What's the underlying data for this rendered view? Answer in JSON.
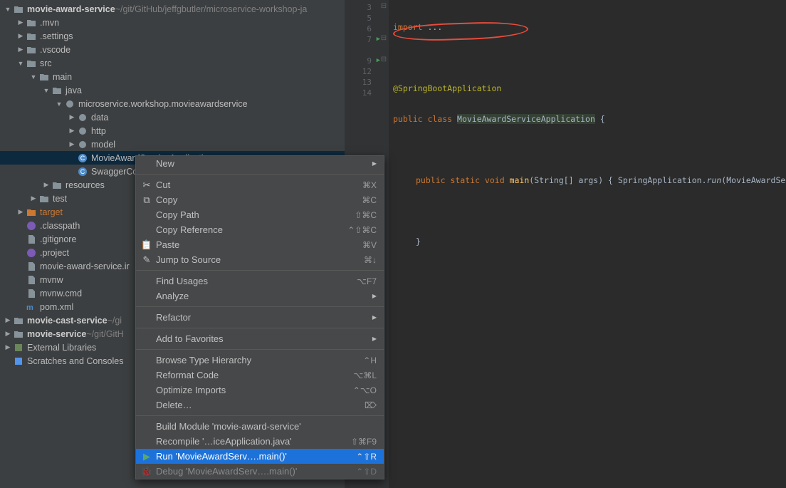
{
  "tree": [
    {
      "indent": 0,
      "chev": "▼",
      "icon": "folder",
      "label": "movie-award-service",
      "bold": true,
      "extra": "~/git/GitHub/jeffgbutler/microservice-workshop-ja"
    },
    {
      "indent": 1,
      "chev": "▶",
      "icon": "folder-dot",
      "label": ".mvn"
    },
    {
      "indent": 1,
      "chev": "▶",
      "icon": "folder",
      "label": ".settings"
    },
    {
      "indent": 1,
      "chev": "▶",
      "icon": "folder-dot",
      "label": ".vscode"
    },
    {
      "indent": 1,
      "chev": "▼",
      "icon": "folder-src",
      "label": "src"
    },
    {
      "indent": 2,
      "chev": "▼",
      "icon": "folder-src",
      "label": "main"
    },
    {
      "indent": 3,
      "chev": "▼",
      "icon": "folder-src",
      "label": "java"
    },
    {
      "indent": 4,
      "chev": "▼",
      "icon": "package",
      "label": "microservice.workshop.movieawardservice"
    },
    {
      "indent": 5,
      "chev": "▶",
      "icon": "package",
      "label": "data"
    },
    {
      "indent": 5,
      "chev": "▶",
      "icon": "package",
      "label": "http"
    },
    {
      "indent": 5,
      "chev": "▶",
      "icon": "package",
      "label": "model"
    },
    {
      "indent": 5,
      "chev": "",
      "icon": "class",
      "label": "MovieAwardServiceApplication",
      "selected": true
    },
    {
      "indent": 5,
      "chev": "",
      "icon": "class",
      "label": "SwaggerCo"
    },
    {
      "indent": 3,
      "chev": "▶",
      "icon": "folder-res",
      "label": "resources"
    },
    {
      "indent": 2,
      "chev": "▶",
      "icon": "folder-src",
      "label": "test"
    },
    {
      "indent": 1,
      "chev": "▶",
      "icon": "folder-orange",
      "label": "target",
      "orange": true
    },
    {
      "indent": 1,
      "chev": "",
      "icon": "eclipse",
      "label": ".classpath"
    },
    {
      "indent": 1,
      "chev": "",
      "icon": "file",
      "label": ".gitignore"
    },
    {
      "indent": 1,
      "chev": "",
      "icon": "eclipse",
      "label": ".project"
    },
    {
      "indent": 1,
      "chev": "",
      "icon": "file",
      "label": "movie-award-service.ir"
    },
    {
      "indent": 1,
      "chev": "",
      "icon": "file",
      "label": "mvnw"
    },
    {
      "indent": 1,
      "chev": "",
      "icon": "file",
      "label": "mvnw.cmd"
    },
    {
      "indent": 1,
      "chev": "",
      "icon": "maven",
      "label": "pom.xml"
    },
    {
      "indent": 0,
      "chev": "▶",
      "icon": "folder",
      "label": "movie-cast-service",
      "bold": true,
      "extra": "~/gi"
    },
    {
      "indent": 0,
      "chev": "▶",
      "icon": "folder",
      "label": "movie-service",
      "bold": true,
      "extra": "~/git/GitH"
    },
    {
      "indent": 0,
      "chev": "▶",
      "icon": "lib",
      "label": "External Libraries"
    },
    {
      "indent": 0,
      "chev": "",
      "icon": "scratch",
      "label": "Scratches and Consoles"
    }
  ],
  "gutter": [
    "3",
    "5",
    "6",
    "7",
    "",
    "9",
    "12",
    "13",
    "14"
  ],
  "runlines": [
    3,
    5
  ],
  "foldmarks": [
    0,
    3,
    5
  ],
  "code": {
    "l0": {
      "pre": "import ",
      "txt": "..."
    },
    "l2": "@SpringBootApplication",
    "l3": {
      "a": "public class ",
      "b": "MovieAwardServiceApplication",
      " c": " {"
    },
    "l5": {
      "a": "public static void ",
      "b": "main",
      "c": "(String[] args) { SpringApplication.",
      "d": "run",
      "e": "(MovieAwardSe"
    },
    "l6": "}",
    "rbrace": "}"
  },
  "menu": [
    {
      "label": "New",
      "sub": true
    },
    {
      "sep": true
    },
    {
      "icon": "cut",
      "label": "Cut",
      "sc": "⌘X"
    },
    {
      "icon": "copy",
      "label": "Copy",
      "sc": "⌘C"
    },
    {
      "label": "Copy Path",
      "sc": "⇧⌘C"
    },
    {
      "label": "Copy Reference",
      "sc": "⌃⇧⌘C"
    },
    {
      "icon": "paste",
      "label": "Paste",
      "sc": "⌘V"
    },
    {
      "icon": "jump",
      "label": "Jump to Source",
      "sc": "⌘↓"
    },
    {
      "sep": true
    },
    {
      "label": "Find Usages",
      "sc": "⌥F7"
    },
    {
      "label": "Analyze",
      "sub": true
    },
    {
      "sep": true
    },
    {
      "label": "Refactor",
      "sub": true
    },
    {
      "sep": true
    },
    {
      "label": "Add to Favorites",
      "sub": true
    },
    {
      "sep": true
    },
    {
      "label": "Browse Type Hierarchy",
      "sc": "⌃H"
    },
    {
      "label": "Reformat Code",
      "sc": "⌥⌘L"
    },
    {
      "label": "Optimize Imports",
      "sc": "⌃⌥O"
    },
    {
      "label": "Delete…",
      "sc": "⌦"
    },
    {
      "sep": true
    },
    {
      "label": "Build Module 'movie-award-service'"
    },
    {
      "label": "Recompile '…iceApplication.java'",
      "sc": "⇧⌘F9"
    },
    {
      "icon": "run",
      "label": "Run 'MovieAwardServ….main()'",
      "sc": "⌃⇧R",
      "hl": true
    },
    {
      "icon": "debug",
      "label": "Debug 'MovieAwardServ….main()'",
      "sc": "⌃⇧D",
      "fade": true
    }
  ]
}
